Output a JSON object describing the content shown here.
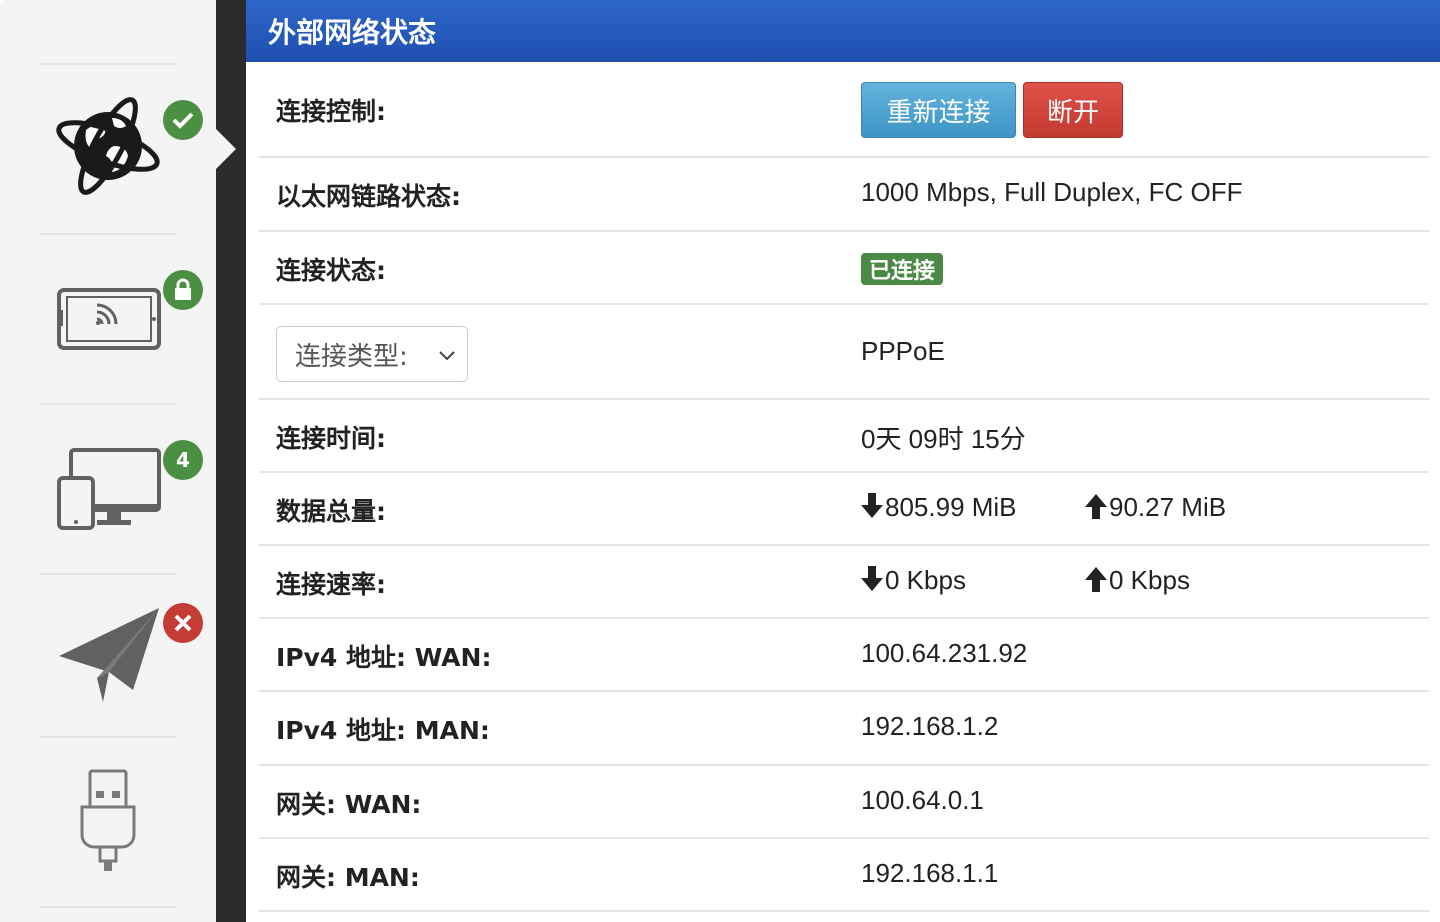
{
  "header": {
    "title": "外部网络状态"
  },
  "sidebar": {
    "items": [
      {
        "icon": "globe-icon",
        "badge_icon": "check-icon",
        "status": "ok"
      },
      {
        "icon": "wireless-tablet-icon",
        "badge_icon": "lock-icon",
        "status": "ok"
      },
      {
        "icon": "devices-icon",
        "badge_text": "4",
        "status": "ok"
      },
      {
        "icon": "paper-plane-icon",
        "badge_icon": "cross-icon",
        "status": "error"
      },
      {
        "icon": "usb-icon"
      }
    ]
  },
  "rows": {
    "control": {
      "label": "连接控制:",
      "reconnect": "重新连接",
      "disconnect": "断开"
    },
    "ethernet": {
      "label": "以太网链路状态:",
      "value": "1000 Mbps, Full Duplex, FC OFF"
    },
    "status": {
      "label": "连接状态:",
      "value": "已连接"
    },
    "type": {
      "select_value": "连接类型:",
      "value": "PPPoE"
    },
    "time": {
      "label": "连接时间:",
      "value": "0天 09时 15分"
    },
    "total": {
      "label": "数据总量:",
      "down": "805.99 MiB",
      "up": "90.27 MiB"
    },
    "rate": {
      "label": "连接速率:",
      "down": "0 Kbps",
      "up": "0 Kbps"
    },
    "ipv4_wan": {
      "label": "IPv4 地址: WAN:",
      "value": "100.64.231.92"
    },
    "ipv4_man": {
      "label": "IPv4 地址: MAN:",
      "value": "192.168.1.2"
    },
    "gw_wan": {
      "label": "网关: WAN:",
      "value": "100.64.0.1"
    },
    "gw_man": {
      "label": "网关: MAN:",
      "value": "192.168.1.1"
    }
  },
  "colors": {
    "header": "#2259bd",
    "ok": "#4a8f42",
    "error": "#c53b35",
    "btn_blue": "#4fa3d2",
    "btn_red": "#cf433a"
  }
}
